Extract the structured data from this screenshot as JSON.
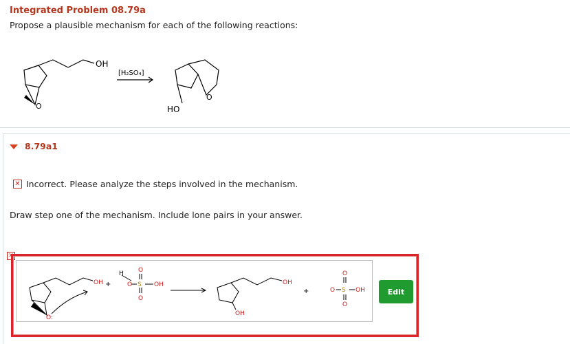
{
  "question": {
    "title": "Integrated Problem 08.79a",
    "instructions": "Propose a plausible mechanism for each of the following reactions:",
    "reaction": {
      "reactant_oh": "OH",
      "reagent": "[H₂SO₄]",
      "product_oh": "HO"
    }
  },
  "part": {
    "label": "8.79a1",
    "feedback": "Incorrect. Please analyze the steps involved in the mechanism.",
    "prompt": "Draw step one of the mechanism. Include lone pairs in your answer."
  },
  "answer": {
    "oh_left": "OH",
    "plus1": "+",
    "h_label": "H",
    "s_label": "S",
    "oh_s1": "OH",
    "oh_mid": "OH",
    "oh_right": "OH",
    "plus2": "+",
    "s_label2": "S",
    "oh_s2": "OH",
    "edit_label": "Edit"
  },
  "colors": {
    "title": "#b5361d",
    "error_red": "#d8252a",
    "oxygen_red": "#d11a1a",
    "sulfur_gold": "#b8860b",
    "edit_green": "#1f9b2f"
  },
  "icons": [
    "caret-down-icon",
    "error-x-icon",
    "curved-arrow-icon"
  ]
}
